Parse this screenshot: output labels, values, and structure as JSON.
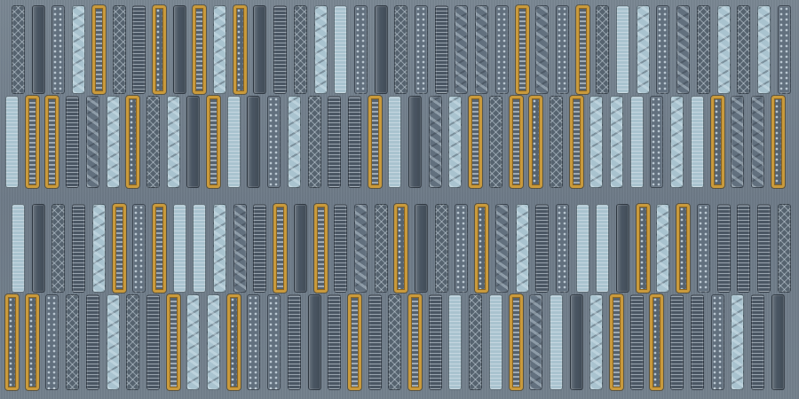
{
  "image": {
    "subject": "decorative-ceramic-tile",
    "colors": {
      "base": "#74818d",
      "gold": "#c99a3c",
      "dark": "#4a5663",
      "mid": "#62707e",
      "light": "#a9c3cf",
      "steel": "#56636f"
    },
    "stripe_styles": [
      "dark-lines",
      "mid-dots",
      "light-swirl",
      "gold-lines",
      "steel-lattice",
      "dark-plain",
      "light-lines",
      "gold-dots",
      "mid-swirl"
    ]
  }
}
